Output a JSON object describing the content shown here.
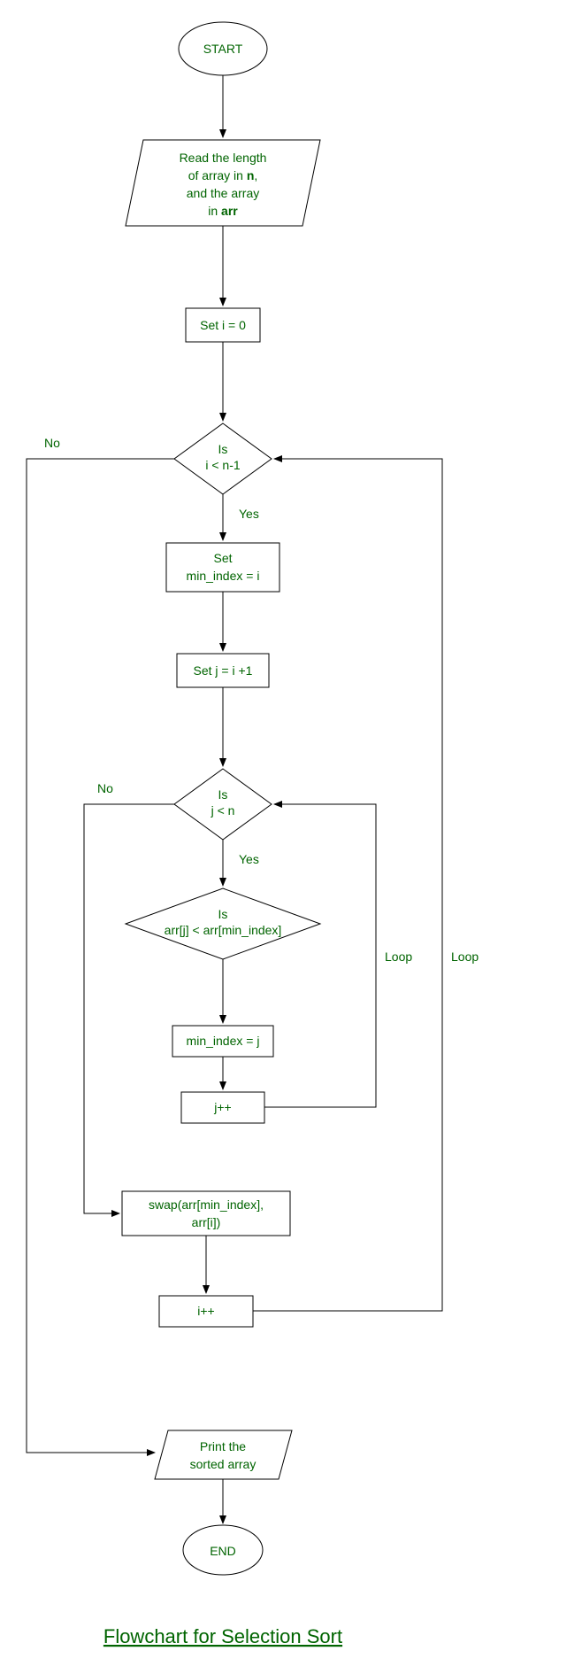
{
  "title": "Flowchart for Selection Sort",
  "nodes": {
    "start": "START",
    "read1": "Read the length",
    "read2a": "of array in ",
    "read2b": "n",
    "read2c": ",",
    "read3": "and the array",
    "read4a": "in ",
    "read4b": "arr",
    "seti": "Set i = 0",
    "dec1a": "Is",
    "dec1b": "i < n-1",
    "setmin1": "Set",
    "setmin2": "min_index = i",
    "setj": "Set j = i +1",
    "dec2a": "Is",
    "dec2b": "j < n",
    "dec3a": "Is",
    "dec3b": "arr[j] < arr[min_index]",
    "minj": "min_index = j",
    "jpp": "j++",
    "swap1": "swap(arr[min_index],",
    "swap2": "arr[i])",
    "ipp": "i++",
    "print1": "Print the",
    "print2": "sorted array",
    "end": "END"
  },
  "edges": {
    "yes": "Yes",
    "no": "No",
    "loop": "Loop"
  }
}
